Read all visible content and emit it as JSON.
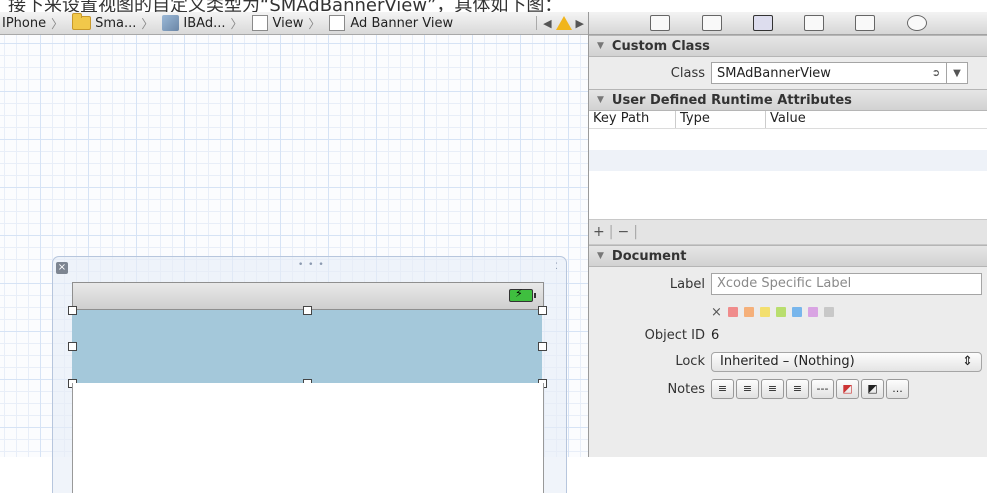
{
  "caption": "接下来设置视图的自定义类型为“SMAdBannerView”，具体如下图：",
  "jumpbar": {
    "crumbs": [
      {
        "label": "IPhone",
        "icon": "none"
      },
      {
        "label": "Sma...",
        "icon": "folder-icon"
      },
      {
        "label": "IBAd...",
        "icon": "xib-icon"
      },
      {
        "label": "View",
        "icon": "view-icon"
      },
      {
        "label": "Ad Banner View",
        "icon": "view-icon"
      }
    ],
    "prev": "◀",
    "next": "▶"
  },
  "inspector": {
    "toolbar_icons": [
      "file-inspector-icon",
      "quick-help-icon",
      "identity-inspector-icon",
      "attributes-inspector-icon",
      "size-inspector-icon",
      "connections-inspector-icon"
    ],
    "custom_class": {
      "title": "Custom Class",
      "class_label": "Class",
      "class_value": "SMAdBannerView"
    },
    "runtime_attributes": {
      "title": "User Defined Runtime Attributes",
      "columns": [
        "Key Path",
        "Type",
        "Value"
      ],
      "add": "+",
      "remove": "−"
    },
    "document": {
      "title": "Document",
      "label_label": "Label",
      "label_placeholder": "Xcode Specific Label",
      "clear_color": "×",
      "label_colors": [
        "#f08c8c",
        "#f5b07a",
        "#f3df6e",
        "#b9de6e",
        "#78b6ec",
        "#d9a4e3",
        "#c8c8c8"
      ],
      "object_id_label": "Object ID",
      "object_id_value": "6",
      "lock_label": "Lock",
      "lock_value": "Inherited – (Nothing)",
      "notes_label": "Notes",
      "notes_buttons": [
        "≡",
        "≡",
        "≡",
        "≡",
        "---",
        "◩",
        "◩",
        "..."
      ]
    }
  }
}
